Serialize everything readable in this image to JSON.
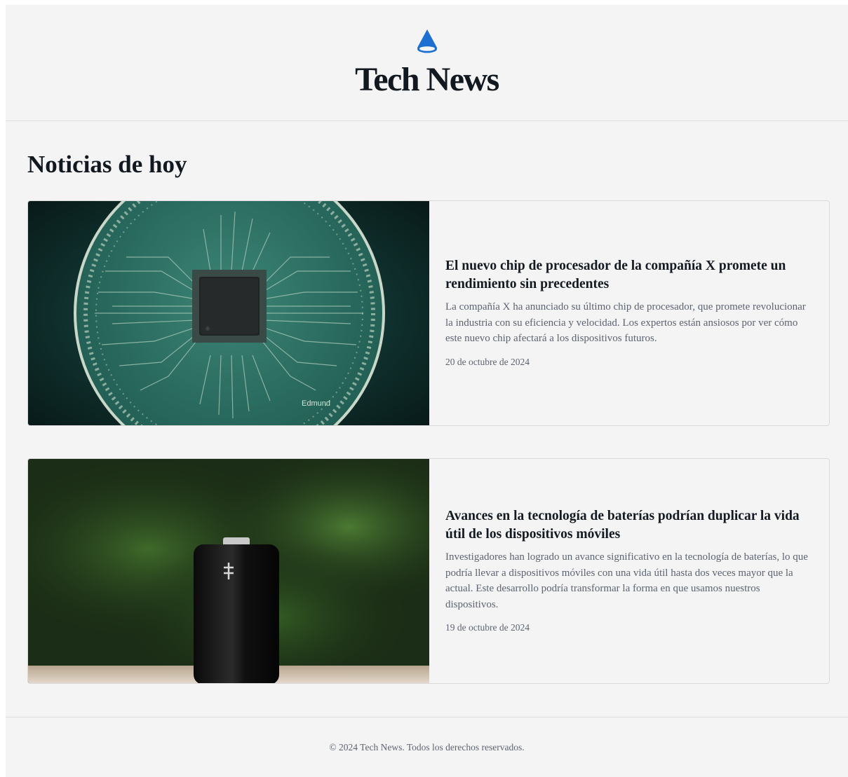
{
  "site": {
    "title": "Tech News",
    "brand_color": "#1d6fd1",
    "logo_icon": "cone-icon"
  },
  "main": {
    "section_title": "Noticias de hoy",
    "articles": [
      {
        "title": "El nuevo chip de procesador de la compañía X promete un rendimiento sin precedentes",
        "summary": "La compañía X ha anunciado su último chip de procesador, que promete revolucionar la industria con su eficiencia y velocidad. Los expertos están ansiosos por ver cómo este nuevo chip afectará a los dispositivos futuros.",
        "date": "20 de octubre de 2024",
        "image_subject": "circuit-board-chip",
        "image_text": "Edmund"
      },
      {
        "title": "Avances en la tecnología de baterías podrían duplicar la vida útil de los dispositivos móviles",
        "summary": "Investigadores han logrado un avance significativo en la tecnología de baterías, lo que podría llevar a dispositivos móviles con una vida útil hasta dos veces mayor que la actual. Este desarrollo podría transformar la forma en que usamos nuestros dispositivos.",
        "date": "19 de octubre de 2024",
        "image_subject": "battery"
      }
    ]
  },
  "footer": {
    "copyright": "© 2024 Tech News. Todos los derechos reservados."
  }
}
